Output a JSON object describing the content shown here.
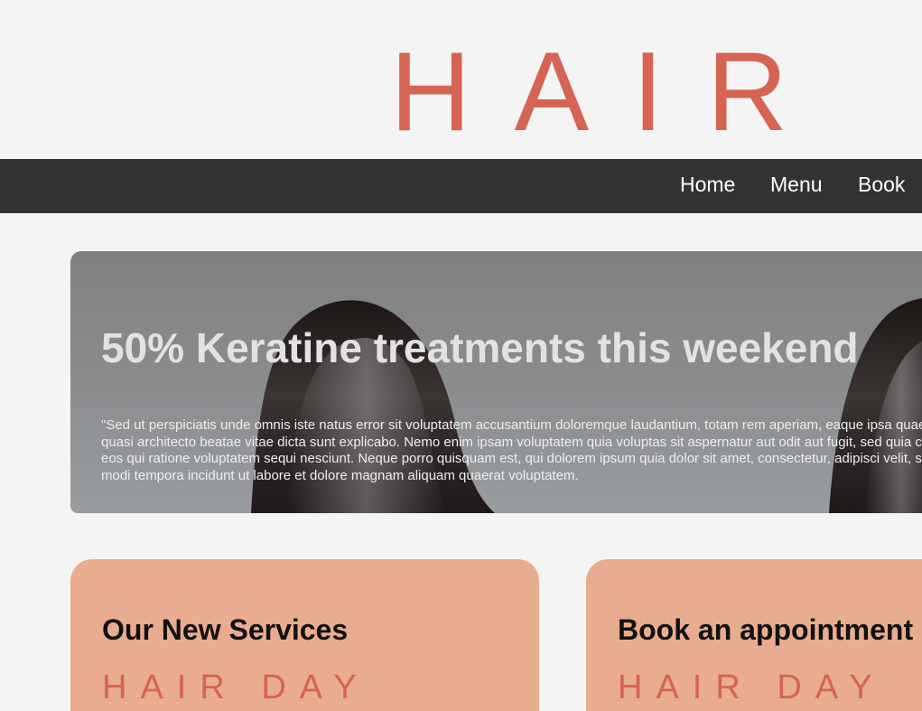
{
  "logo": {
    "text": "HAIR"
  },
  "nav": {
    "items": [
      {
        "label": "Home"
      },
      {
        "label": "Menu"
      },
      {
        "label": "Book"
      }
    ]
  },
  "hero": {
    "title": "50% Keratine treatments this weekend",
    "text": "\"Sed ut perspiciatis unde omnis iste natus error sit voluptatem accusantium doloremque laudantium, totam rem aperiam, eaque ipsa quae ab illo inventore veritatis et quasi architecto beatae vitae dicta sunt explicabo. Nemo enim ipsam voluptatem quia voluptas sit aspernatur aut odit aut fugit, sed quia consequuntur magni dolores eos qui ratione voluptatem sequi nesciunt. Neque porro quisquam est, qui dolorem ipsum quia dolor sit amet, consectetur, adipisci velit, sed quia non numquam eius modi tempora incidunt ut labore et dolore magnam aliquam quaerat voluptatem."
  },
  "cards": [
    {
      "title": "Our New Services",
      "subtitle": "HAIR DAY"
    },
    {
      "title": "Book an appointment",
      "subtitle": "HAIR DAY"
    }
  ],
  "colors": {
    "accent": "#d56452",
    "navbar": "#333333",
    "card": "#e9ac90",
    "background": "#f4f4f4"
  }
}
